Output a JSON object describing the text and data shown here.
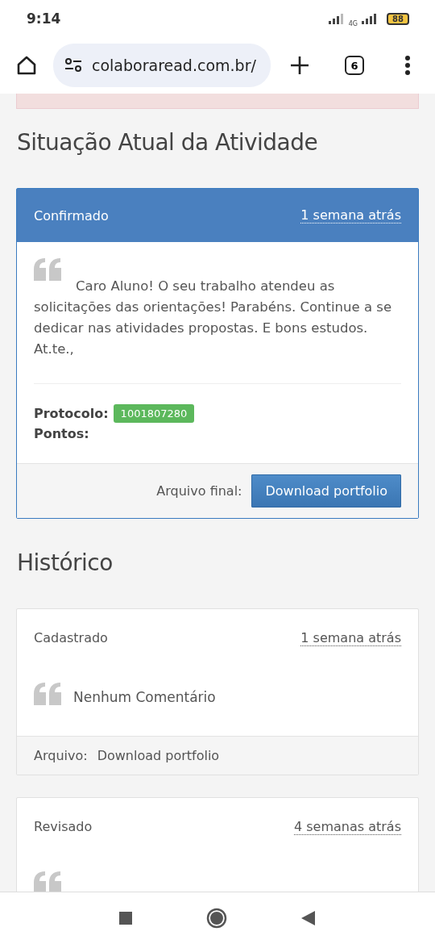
{
  "status_bar": {
    "time": "9:14",
    "network": "4G",
    "battery": "88"
  },
  "browser": {
    "url": "colaboraread.com.br/",
    "tab_count": "6"
  },
  "section_title": "Situação Atual da Atividade",
  "current": {
    "status": "Confirmado",
    "time": "1 semana atrás",
    "comment": "Caro Aluno! O seu trabalho atendeu as solicitações das orientações! Parabéns. Continue a se dedicar nas atividades propostas. E bons estudos. At.te.,",
    "protocol_label": "Protocolo:",
    "protocol": "1001807280",
    "points_label": "Pontos:",
    "file_label": "Arquivo final:",
    "button": "Download portfolio"
  },
  "history_title": "Histórico",
  "history": [
    {
      "status": "Cadastrado",
      "time": "1 semana atrás",
      "comment": "Nenhum Comentário",
      "file_label": "Arquivo:",
      "file_link": "Download portfolio"
    },
    {
      "status": "Revisado",
      "time": "4 semanas atrás"
    }
  ]
}
